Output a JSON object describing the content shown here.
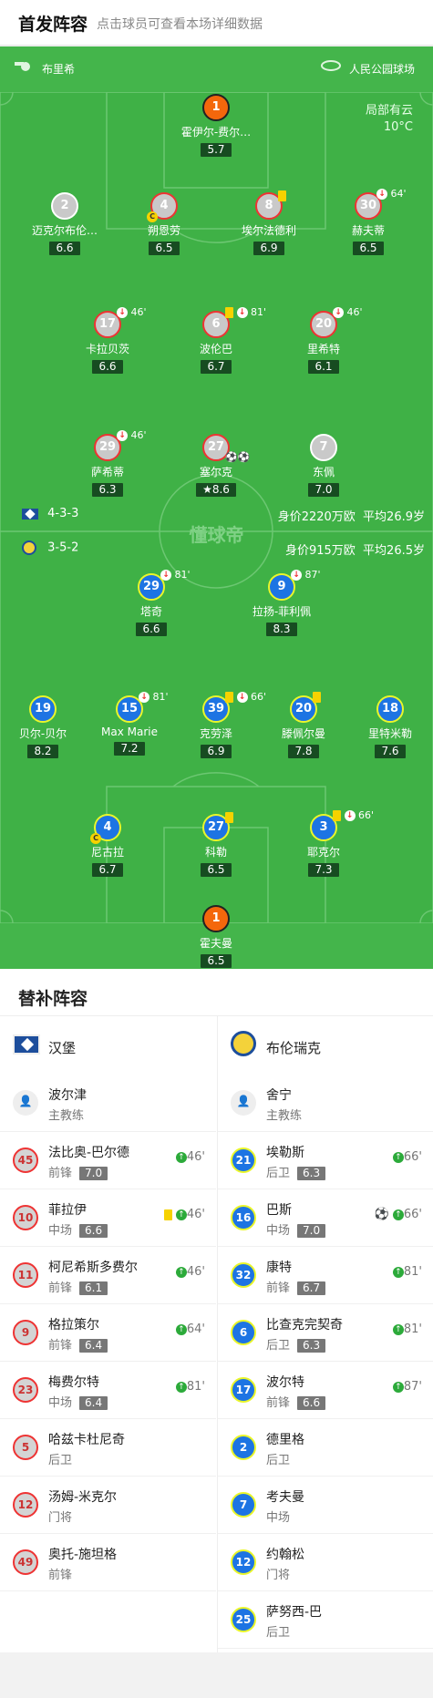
{
  "header": {
    "title": "首发阵容",
    "subtitle": "点击球员可查看本场详细数据"
  },
  "pitch": {
    "referee": "布里希",
    "stadium": "人民公园球场",
    "weather_line1": "局部有云",
    "weather_line2": "10°C",
    "home_formation": "4-3-3",
    "home_value": "身价2220万欧",
    "home_age": "平均26.9岁",
    "away_formation": "3-5-2",
    "away_value": "身价915万欧",
    "away_age": "平均26.5岁",
    "watermark": "懂球帝"
  },
  "home_players": [
    {
      "num": "1",
      "name": "霍伊尔-费尔…",
      "rating": "5.7"
    },
    {
      "num": "2",
      "name": "迈克尔布伦…",
      "rating": "6.6"
    },
    {
      "num": "4",
      "name": "朔恩劳",
      "rating": "6.5"
    },
    {
      "num": "8",
      "name": "埃尔法德利",
      "rating": "6.9"
    },
    {
      "num": "30",
      "name": "赫夫蒂",
      "rating": "6.5",
      "sub": "64'"
    },
    {
      "num": "17",
      "name": "卡拉贝茨",
      "rating": "6.6",
      "sub": "46'"
    },
    {
      "num": "6",
      "name": "波伦巴",
      "rating": "6.7",
      "sub": "81'"
    },
    {
      "num": "20",
      "name": "里希特",
      "rating": "6.1",
      "sub": "46'"
    },
    {
      "num": "29",
      "name": "萨希蒂",
      "rating": "6.3",
      "sub": "46'"
    },
    {
      "num": "27",
      "name": "塞尔克",
      "rating": "8.6"
    },
    {
      "num": "7",
      "name": "东佩",
      "rating": "7.0"
    }
  ],
  "away_players": [
    {
      "num": "29",
      "name": "塔奇",
      "rating": "6.6",
      "sub": "81'"
    },
    {
      "num": "9",
      "name": "拉扬-菲利佩",
      "rating": "8.3",
      "sub": "87'"
    },
    {
      "num": "19",
      "name": "贝尔-贝尔",
      "rating": "8.2"
    },
    {
      "num": "15",
      "name": "Max Marie",
      "rating": "7.2",
      "sub": "81'"
    },
    {
      "num": "39",
      "name": "克劳泽",
      "rating": "6.9",
      "sub": "66'"
    },
    {
      "num": "20",
      "name": "滕佩尔曼",
      "rating": "7.8"
    },
    {
      "num": "18",
      "name": "里特米勒",
      "rating": "7.6"
    },
    {
      "num": "4",
      "name": "尼古拉",
      "rating": "6.7"
    },
    {
      "num": "27",
      "name": "科勒",
      "rating": "6.5"
    },
    {
      "num": "3",
      "name": "耶克尔",
      "rating": "7.3",
      "sub": "66'"
    },
    {
      "num": "1",
      "name": "霍夫曼",
      "rating": "6.5"
    }
  ],
  "bench": {
    "title": "替补阵容",
    "home_team": "汉堡",
    "away_team": "布伦瑞克",
    "home_coach": {
      "name": "波尔津",
      "role": "主教练"
    },
    "away_coach": {
      "name": "舍宁",
      "role": "主教练"
    },
    "home": [
      {
        "num": "45",
        "name": "法比奥-巴尔德",
        "pos": "前锋",
        "rating": "7.0",
        "time": "46'"
      },
      {
        "num": "10",
        "name": "菲拉伊",
        "pos": "中场",
        "rating": "6.6",
        "time": "46'"
      },
      {
        "num": "11",
        "name": "柯尼希斯多费尔",
        "pos": "前锋",
        "rating": "6.1",
        "time": "46'"
      },
      {
        "num": "9",
        "name": "格拉策尔",
        "pos": "前锋",
        "rating": "6.4",
        "time": "64'"
      },
      {
        "num": "23",
        "name": "梅费尔特",
        "pos": "中场",
        "rating": "6.4",
        "time": "81'"
      },
      {
        "num": "5",
        "name": "哈兹卡杜尼奇",
        "pos": "后卫",
        "rating": "",
        "time": ""
      },
      {
        "num": "12",
        "name": "汤姆-米克尔",
        "pos": "门将",
        "rating": "",
        "time": ""
      },
      {
        "num": "49",
        "name": "奥托-施坦格",
        "pos": "前锋",
        "rating": "",
        "time": ""
      }
    ],
    "away": [
      {
        "num": "21",
        "name": "埃勒斯",
        "pos": "后卫",
        "rating": "6.3",
        "time": "66'"
      },
      {
        "num": "16",
        "name": "巴斯",
        "pos": "中场",
        "rating": "7.0",
        "time": "66'"
      },
      {
        "num": "32",
        "name": "康特",
        "pos": "前锋",
        "rating": "6.7",
        "time": "81'"
      },
      {
        "num": "6",
        "name": "比查克完契奇",
        "pos": "后卫",
        "rating": "6.3",
        "time": "81'"
      },
      {
        "num": "17",
        "name": "波尔特",
        "pos": "前锋",
        "rating": "6.6",
        "time": "87'"
      },
      {
        "num": "2",
        "name": "德里格",
        "pos": "后卫",
        "rating": "",
        "time": ""
      },
      {
        "num": "7",
        "name": "考夫曼",
        "pos": "中场",
        "rating": "",
        "time": ""
      },
      {
        "num": "12",
        "name": "约翰松",
        "pos": "门将",
        "rating": "",
        "time": ""
      },
      {
        "num": "25",
        "name": "萨努西-巴",
        "pos": "后卫",
        "rating": "",
        "time": ""
      }
    ]
  }
}
